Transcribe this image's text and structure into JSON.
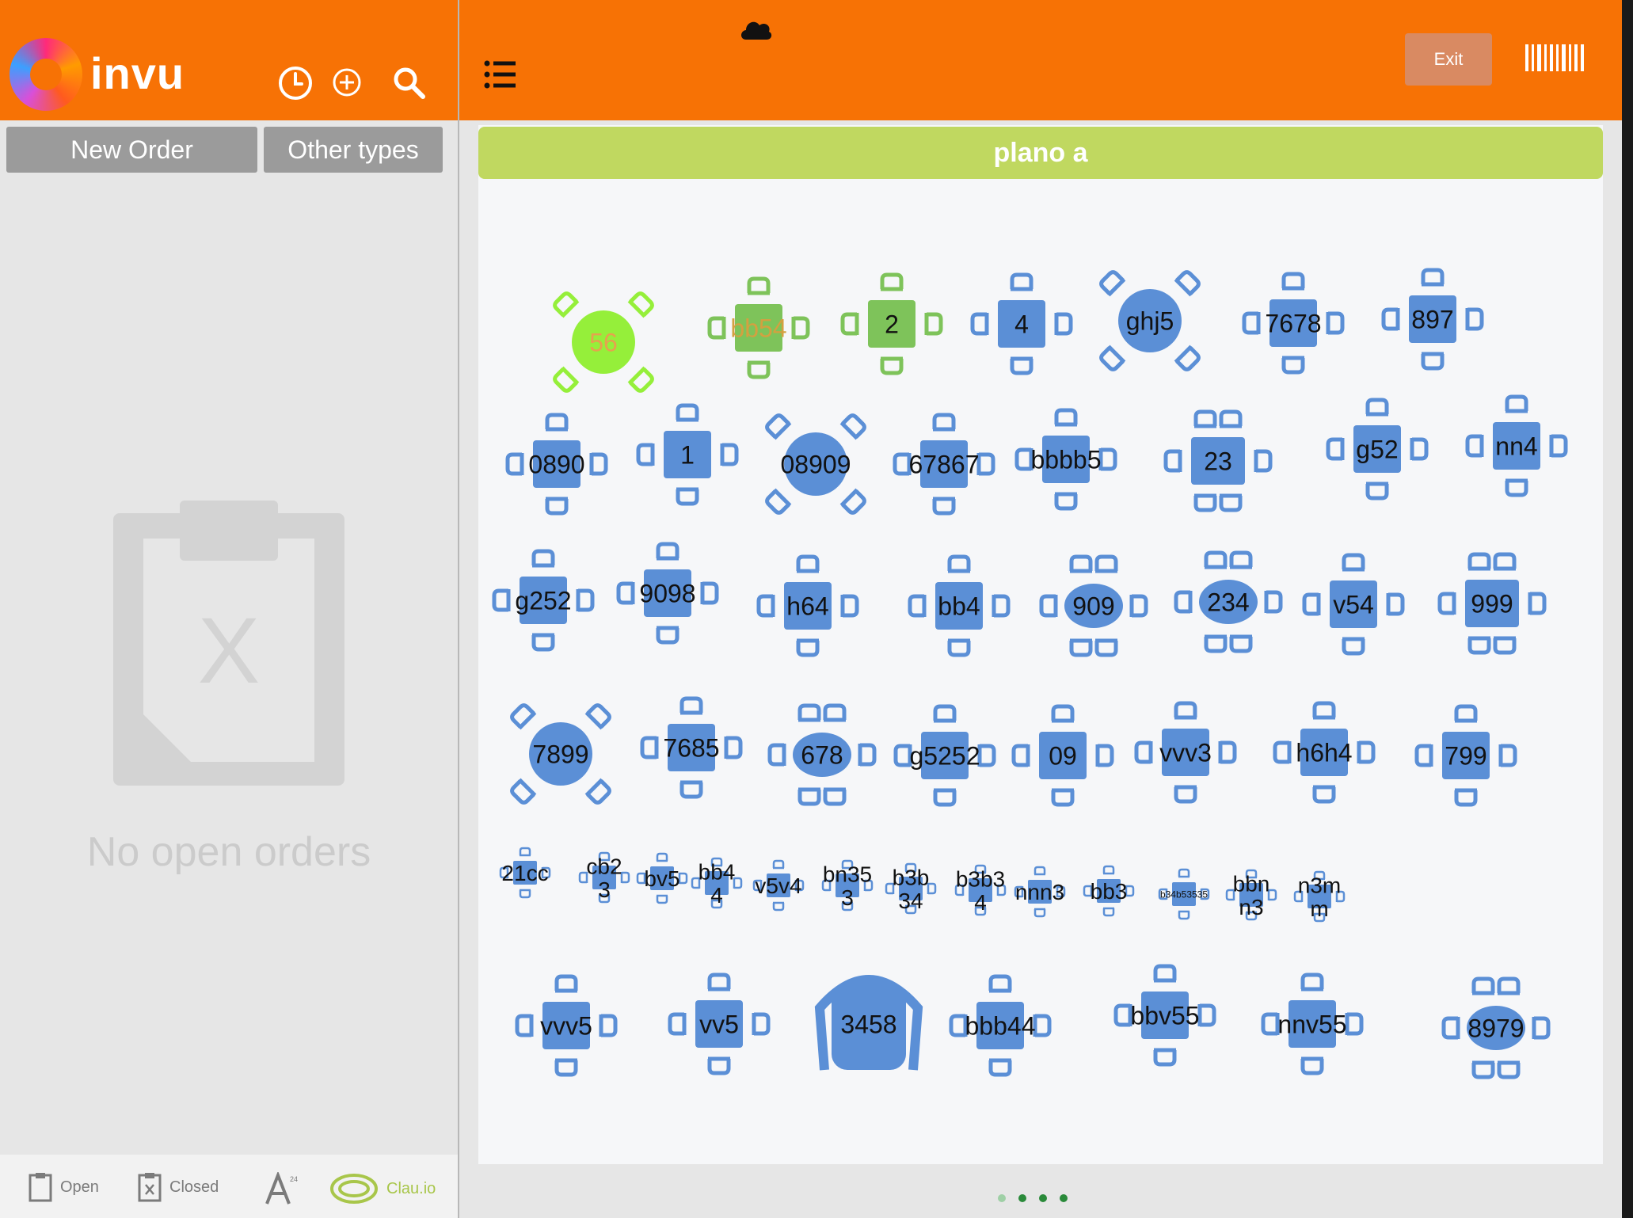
{
  "app": {
    "logo_text": "invu"
  },
  "header": {
    "icons": [
      "clock-icon",
      "plus-circle-icon",
      "search-icon",
      "list-icon",
      "cloud-icon",
      "barcode-icon"
    ],
    "exit_label": "Exit"
  },
  "left_tabs": {
    "new_order": "New Order",
    "other_types": "Other types"
  },
  "empty_state": {
    "message": "No open orders",
    "clipboard_mark": "X"
  },
  "bottom_nav": {
    "open": "Open",
    "closed": "Closed",
    "font_superscript": "24",
    "brand": "Clau.io"
  },
  "floor": {
    "name": "plano a",
    "tables": [
      {
        "label": "56",
        "shape": "round",
        "chairs": "diag",
        "status": "lime"
      },
      {
        "label": "bb54",
        "shape": "square",
        "chairs": "four",
        "status": "green"
      },
      {
        "label": "2",
        "shape": "square",
        "chairs": "four",
        "status": "green"
      },
      {
        "label": "4",
        "shape": "square",
        "chairs": "four",
        "status": "blue"
      },
      {
        "label": "ghj5",
        "shape": "round",
        "chairs": "diag",
        "status": "blue"
      },
      {
        "label": "7678",
        "shape": "square",
        "chairs": "four",
        "status": "blue"
      },
      {
        "label": "897",
        "shape": "square",
        "chairs": "four",
        "status": "blue"
      },
      {
        "label": "0890",
        "shape": "square",
        "chairs": "four",
        "status": "blue"
      },
      {
        "label": "1",
        "shape": "square",
        "chairs": "four",
        "status": "blue"
      },
      {
        "label": "08909",
        "shape": "round",
        "chairs": "diag",
        "status": "blue"
      },
      {
        "label": "67867",
        "shape": "square",
        "chairs": "four",
        "status": "blue"
      },
      {
        "label": "bbbb5",
        "shape": "square",
        "chairs": "four",
        "status": "blue"
      },
      {
        "label": "23",
        "shape": "square",
        "chairs": "six",
        "status": "blue"
      },
      {
        "label": "g52",
        "shape": "square",
        "chairs": "four",
        "status": "blue"
      },
      {
        "label": "nn4",
        "shape": "square",
        "chairs": "four",
        "status": "blue"
      },
      {
        "label": "g252",
        "shape": "square",
        "chairs": "four",
        "status": "blue"
      },
      {
        "label": "9098",
        "shape": "square",
        "chairs": "four",
        "status": "blue"
      },
      {
        "label": "h64",
        "shape": "square",
        "chairs": "four",
        "status": "blue"
      },
      {
        "label": "bb4",
        "shape": "square",
        "chairs": "four",
        "status": "blue"
      },
      {
        "label": "909",
        "shape": "oval",
        "chairs": "six",
        "status": "blue"
      },
      {
        "label": "234",
        "shape": "oval",
        "chairs": "six",
        "status": "blue"
      },
      {
        "label": "v54",
        "shape": "square",
        "chairs": "four",
        "status": "blue"
      },
      {
        "label": "999",
        "shape": "square",
        "chairs": "six",
        "status": "blue"
      },
      {
        "label": "7899",
        "shape": "round",
        "chairs": "diag",
        "status": "blue"
      },
      {
        "label": "7685",
        "shape": "square",
        "chairs": "four",
        "status": "blue"
      },
      {
        "label": "678",
        "shape": "oval",
        "chairs": "six",
        "status": "blue"
      },
      {
        "label": "g5252",
        "shape": "square",
        "chairs": "four",
        "status": "blue"
      },
      {
        "label": "09",
        "shape": "square",
        "chairs": "four",
        "status": "blue"
      },
      {
        "label": "vvv3",
        "shape": "square",
        "chairs": "four",
        "status": "blue"
      },
      {
        "label": "h6h4",
        "shape": "square",
        "chairs": "four",
        "status": "blue"
      },
      {
        "label": "799",
        "shape": "square",
        "chairs": "four",
        "status": "blue"
      },
      {
        "label": "21cc",
        "shape": "square",
        "chairs": "four",
        "status": "blue"
      },
      {
        "label": "cb2\n3",
        "shape": "square",
        "chairs": "four",
        "status": "blue"
      },
      {
        "label": "bv5",
        "shape": "square",
        "chairs": "four",
        "status": "blue"
      },
      {
        "label": "bb4\n4",
        "shape": "square",
        "chairs": "four",
        "status": "blue"
      },
      {
        "label": "v5v4",
        "shape": "square",
        "chairs": "four",
        "status": "blue"
      },
      {
        "label": "bn35\n3",
        "shape": "square",
        "chairs": "four",
        "status": "blue"
      },
      {
        "label": "b3b\n34",
        "shape": "square",
        "chairs": "four",
        "status": "blue"
      },
      {
        "label": "b3b3\n4",
        "shape": "square",
        "chairs": "four",
        "status": "blue"
      },
      {
        "label": "nnn3",
        "shape": "square",
        "chairs": "four",
        "status": "blue"
      },
      {
        "label": "bb3",
        "shape": "square",
        "chairs": "four",
        "status": "blue"
      },
      {
        "label": "b34b53535",
        "shape": "square",
        "chairs": "four",
        "status": "blue"
      },
      {
        "label": "bbn\nn3",
        "shape": "square",
        "chairs": "four",
        "status": "blue"
      },
      {
        "label": "n3m\nm",
        "shape": "square",
        "chairs": "four",
        "status": "blue"
      },
      {
        "label": "vvv5",
        "shape": "square",
        "chairs": "four",
        "status": "blue"
      },
      {
        "label": "vv5",
        "shape": "square",
        "chairs": "four",
        "status": "blue"
      },
      {
        "label": "3458",
        "shape": "booth",
        "chairs": "none",
        "status": "blue"
      },
      {
        "label": "bbb44",
        "shape": "square",
        "chairs": "four",
        "status": "blue"
      },
      {
        "label": "bbv55",
        "shape": "square",
        "chairs": "four",
        "status": "blue"
      },
      {
        "label": "nnv55",
        "shape": "square",
        "chairs": "four",
        "status": "blue"
      },
      {
        "label": "8979",
        "shape": "oval",
        "chairs": "six",
        "status": "blue"
      }
    ]
  },
  "pagination": {
    "pages": 4,
    "current": 1
  },
  "colors": {
    "orange": "#f77205",
    "table_blue": "#5b8fd6",
    "chair_blue": "#5b8fd6",
    "green": "#7ec35a",
    "lime": "#95ef3a",
    "plan_header": "#c0d860"
  }
}
